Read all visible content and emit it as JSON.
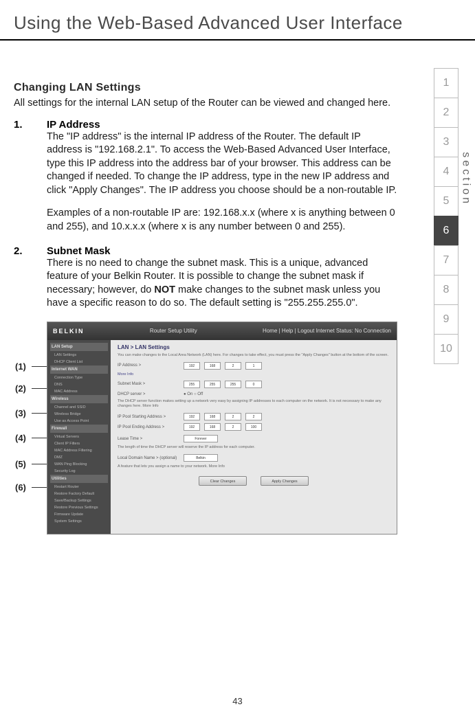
{
  "page": {
    "title": "Using the Web-Based Advanced User Interface",
    "number": "43",
    "section_label": "section"
  },
  "tabs": {
    "items": [
      "1",
      "2",
      "3",
      "4",
      "5",
      "6",
      "7",
      "8",
      "9",
      "10"
    ],
    "active": "6"
  },
  "content": {
    "heading": "Changing LAN Settings",
    "intro": "All settings for the internal LAN setup of the Router can be viewed and changed here.",
    "item1": {
      "num": "1.",
      "title": "IP Address",
      "p1": "The \"IP address\" is the internal IP address of the Router. The default IP address is \"192.168.2.1\". To access the Web-Based Advanced User Interface, type this IP address into the address bar of your browser. This address can be changed if needed. To change the IP address, type in the new IP address and click \"Apply Changes\". The IP address you choose should be a non-routable IP.",
      "p2": "Examples of a non-routable IP are: 192.168.x.x (where x is anything between 0 and 255), and 10.x.x.x (where x is any number between 0 and 255)."
    },
    "item2": {
      "num": "2.",
      "title": "Subnet Mask",
      "p1_a": "There is no need to change the subnet mask. This is a unique, advanced feature of your Belkin Router. It is possible to change the subnet mask if necessary; however, do ",
      "p1_bold": "NOT",
      "p1_b": " make changes to the subnet mask unless you have a specific reason to do so. The default setting is \"255.255.255.0\"."
    }
  },
  "callouts": [
    "(1)",
    "(2)",
    "(3)",
    "(4)",
    "(5)",
    "(6)"
  ],
  "screenshot": {
    "logo": "BELKIN",
    "util_title": "Router Setup Utility",
    "header_right": "Home | Help | Logout   Internet Status: No Connection",
    "panel_title": "LAN > LAN Settings",
    "desc": "You can make changes to the Local Area Network (LAN) here. For changes to take effect, you must press the \"Apply Changes\" button at the bottom of the screen.",
    "rows": {
      "ip_label": "IP Address >",
      "ip_vals": [
        "192",
        "168",
        "2",
        "1"
      ],
      "more_info": "More Info",
      "subnet_label": "Subnet Mask >",
      "subnet_vals": [
        "255",
        "255",
        "255",
        "0"
      ],
      "dhcp_label": "DHCP server >",
      "dhcp_opts": "● On ○ Off",
      "dhcp_desc": "The DHCP server function makes setting up a network very easy by assigning IP addresses to each computer on the network. It is not necessary to make any changes here. More Info",
      "pool_start_label": "IP Pool Starting Address >",
      "pool_start_vals": [
        "192",
        "168",
        "2",
        "2"
      ],
      "pool_end_label": "IP Pool Ending Address >",
      "pool_end_vals": [
        "192",
        "168",
        "2",
        "100"
      ],
      "lease_label": "Lease Time >",
      "lease_val": "Forever",
      "lease_desc": "The length of time the DHCP server will reserve the IP address for each computer.",
      "domain_label": "Local Domain Name > (optional)",
      "domain_val": "Belkin",
      "domain_desc": "A feature that lets you assign a name to your network. More Info"
    },
    "btn_clear": "Clear Changes",
    "btn_apply": "Apply Changes",
    "sidebar": {
      "sec1": "LAN Setup",
      "s1_items": [
        "LAN Settings",
        "DHCP Client List"
      ],
      "sec2": "Internet WAN",
      "s2_items": [
        "Connection Type",
        "DNS",
        "MAC Address"
      ],
      "sec3": "Wireless",
      "s3_items": [
        "Channel and SSID",
        "Wireless Bridge",
        "Use as Access Point"
      ],
      "sec4": "Firewall",
      "s4_items": [
        "Virtual Servers",
        "Client IP Filters",
        "MAC Address Filtering",
        "DMZ",
        "WAN Ping Blocking",
        "Security Log"
      ],
      "sec5": "Utilities",
      "s5_items": [
        "Restart Router",
        "Restore Factory Default",
        "Save/Backup Settings",
        "Restore Previous Settings",
        "Firmware Update",
        "System Settings"
      ]
    }
  }
}
